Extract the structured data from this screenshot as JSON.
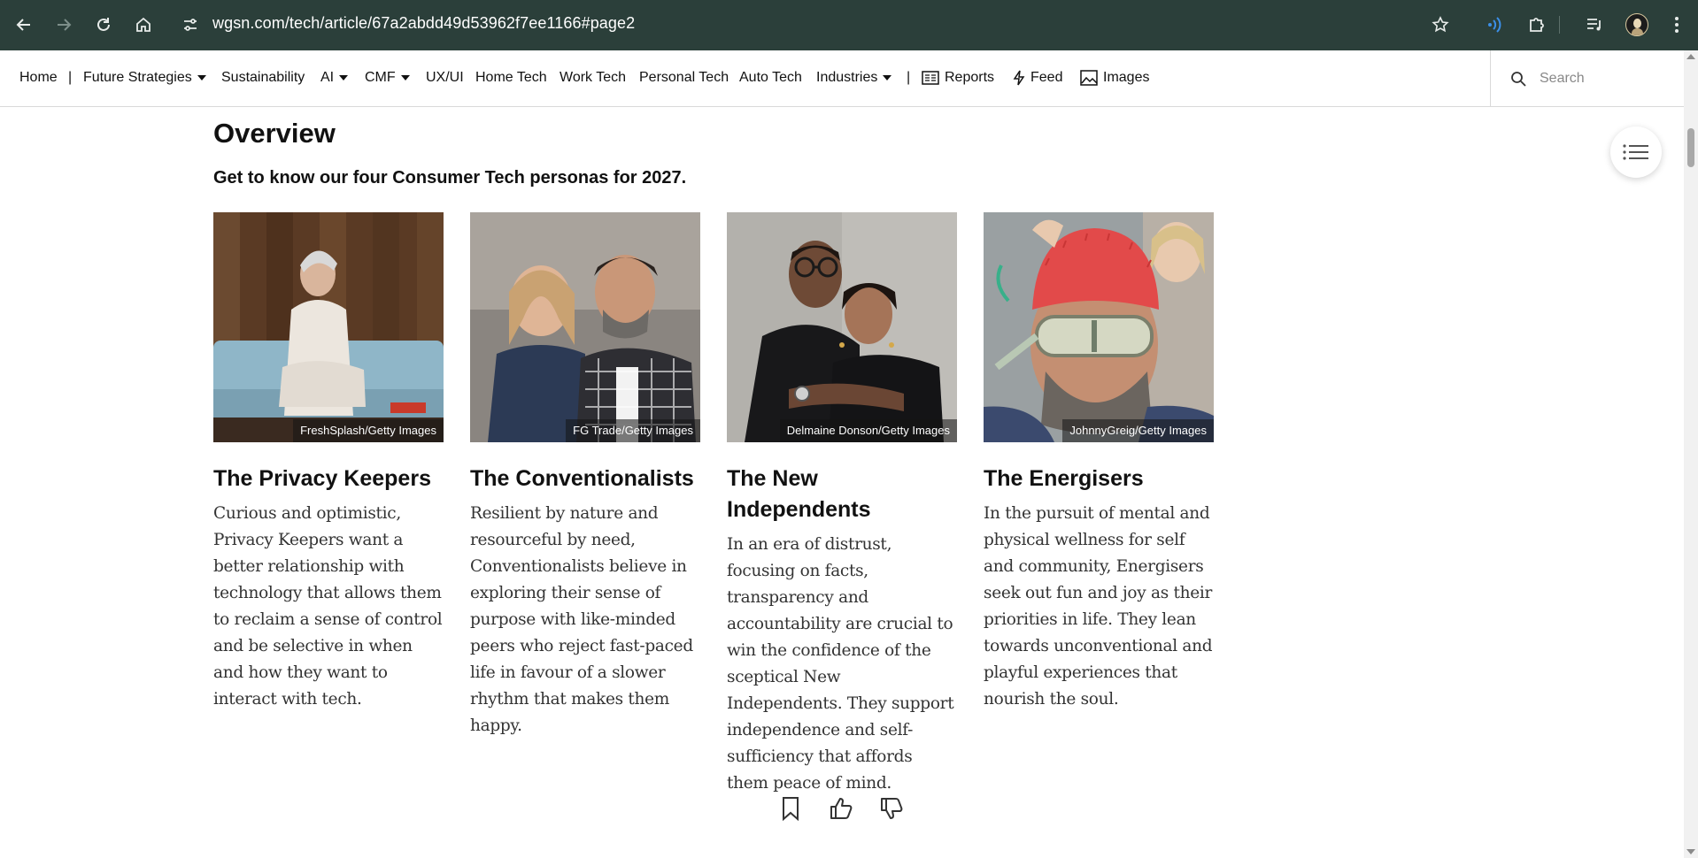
{
  "browser": {
    "url": "wgsn.com/tech/article/67a2abdd49d53962f7ee1166#page2"
  },
  "nav": {
    "items": [
      {
        "label": "Home"
      },
      {
        "label": "Future Strategies"
      },
      {
        "label": "Sustainability"
      },
      {
        "label": "AI"
      },
      {
        "label": "CMF"
      },
      {
        "label": "UX/UI"
      },
      {
        "label": "Home Tech"
      },
      {
        "label": "Work Tech"
      },
      {
        "label": "Personal Tech"
      },
      {
        "label": "Auto Tech"
      },
      {
        "label": "Industries"
      },
      {
        "label": "Reports"
      },
      {
        "label": "Feed"
      },
      {
        "label": "Images"
      }
    ],
    "separator": "|",
    "search_placeholder": "Search"
  },
  "article": {
    "heading": "Overview",
    "subtitle": "Get to know our four Consumer Tech personas for 2027.",
    "personas": [
      {
        "title": "The Privacy Keepers",
        "credit": "FreshSplash/Getty Images",
        "text": "Curious and optimistic, Privacy Keepers want a better relationship with technology that allows them to reclaim a sense of control and be selective in when and how they want to interact with tech."
      },
      {
        "title": "The Conventionalists",
        "credit": "FG Trade/Getty Images",
        "text": "Resilient by nature and resourceful by need, Conventionalists believe in exploring their sense of purpose with like-minded peers who reject fast-paced life in favour of a slower rhythm that makes them happy."
      },
      {
        "title": "The New Independents",
        "credit": "Delmaine Donson/Getty Images",
        "text": "In an era of distrust, focusing on facts, transparency and accountability are crucial to win the confidence of the sceptical New Independents. They support independence and self-sufficiency that affords them peace of mind."
      },
      {
        "title": "The Energisers",
        "credit": "JohnnyGreig/Getty Images",
        "text": "In the pursuit of mental and physical wellness for self and community, Energisers seek out fun and joy as their priorities in life. They lean towards unconventional and playful experiences that nourish the soul."
      }
    ]
  },
  "icons": {
    "back": "arrow-left-icon",
    "forward": "arrow-right-icon",
    "reload": "reload-icon",
    "home": "home-icon",
    "site_info": "tune-icon",
    "bookmark_star": "star-icon",
    "extensions": "puzzle-icon",
    "toc": "list-icon",
    "save": "bookmark-icon",
    "like": "thumbs-up-icon",
    "dislike": "thumbs-down-icon"
  }
}
